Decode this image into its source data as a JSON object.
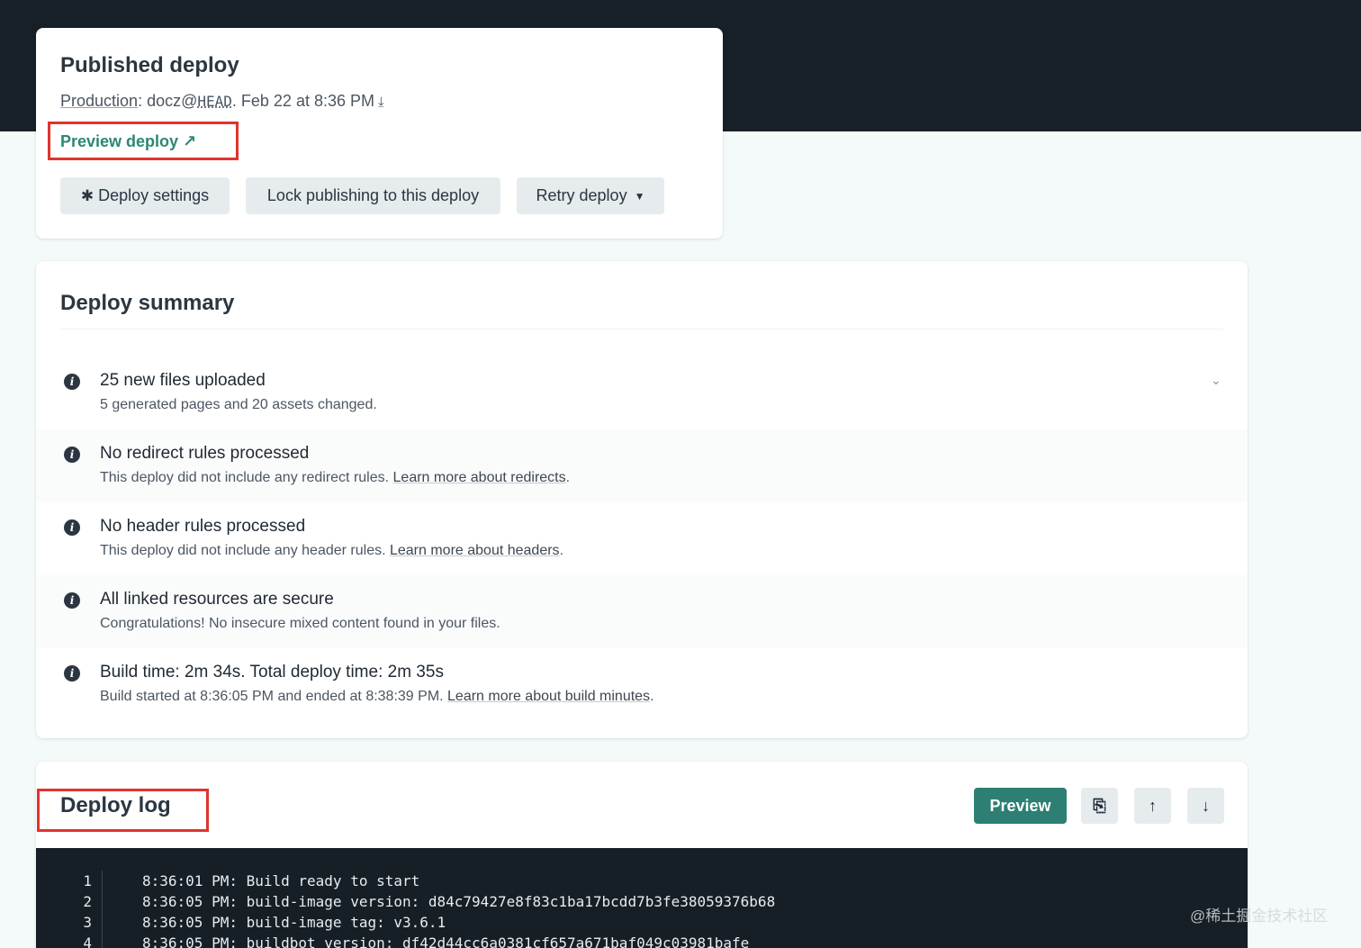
{
  "published_deploy": {
    "title": "Published deploy",
    "context_label": "Production",
    "branch": "docz@",
    "ref": "HEAD",
    "date_text": ". Feb 22 at 8:36 PM",
    "preview_link": "Preview deploy ↗",
    "buttons": {
      "settings": "Deploy settings",
      "lock": "Lock publishing to this deploy",
      "retry": "Retry deploy"
    }
  },
  "summary": {
    "title": "Deploy summary",
    "items": [
      {
        "title": "25 new files uploaded",
        "desc": "5 generated pages and 20 assets changed.",
        "more": ""
      },
      {
        "title": "No redirect rules processed",
        "desc": "This deploy did not include any redirect rules. ",
        "more": "Learn more about redirects"
      },
      {
        "title": "No header rules processed",
        "desc": "This deploy did not include any header rules. ",
        "more": "Learn more about headers"
      },
      {
        "title": "All linked resources are secure",
        "desc": "Congratulations! No insecure mixed content found in your files.",
        "more": ""
      },
      {
        "title": "Build time: 2m 34s. Total deploy time: 2m 35s",
        "desc": "Build started at 8:36:05 PM and ended at 8:38:39 PM. ",
        "more": "Learn more about build minutes"
      }
    ]
  },
  "log": {
    "title": "Deploy log",
    "preview_button": "Preview",
    "lines": [
      {
        "n": "1",
        "text": "8:36:01 PM: Build ready to start"
      },
      {
        "n": "2",
        "text": "8:36:05 PM: build-image version: d84c79427e8f83c1ba17bcdd7b3fe38059376b68"
      },
      {
        "n": "3",
        "text": "8:36:05 PM: build-image tag: v3.6.1"
      },
      {
        "n": "4",
        "text": "8:36:05 PM: buildbot version: df42d44cc6a0381cf657a671baf049c03981bafe"
      }
    ]
  },
  "watermark": "@稀土掘金技术社区",
  "colors": {
    "header_bg": "#172027",
    "accent_green": "#2c7f72",
    "highlight_red": "#e0342c"
  }
}
